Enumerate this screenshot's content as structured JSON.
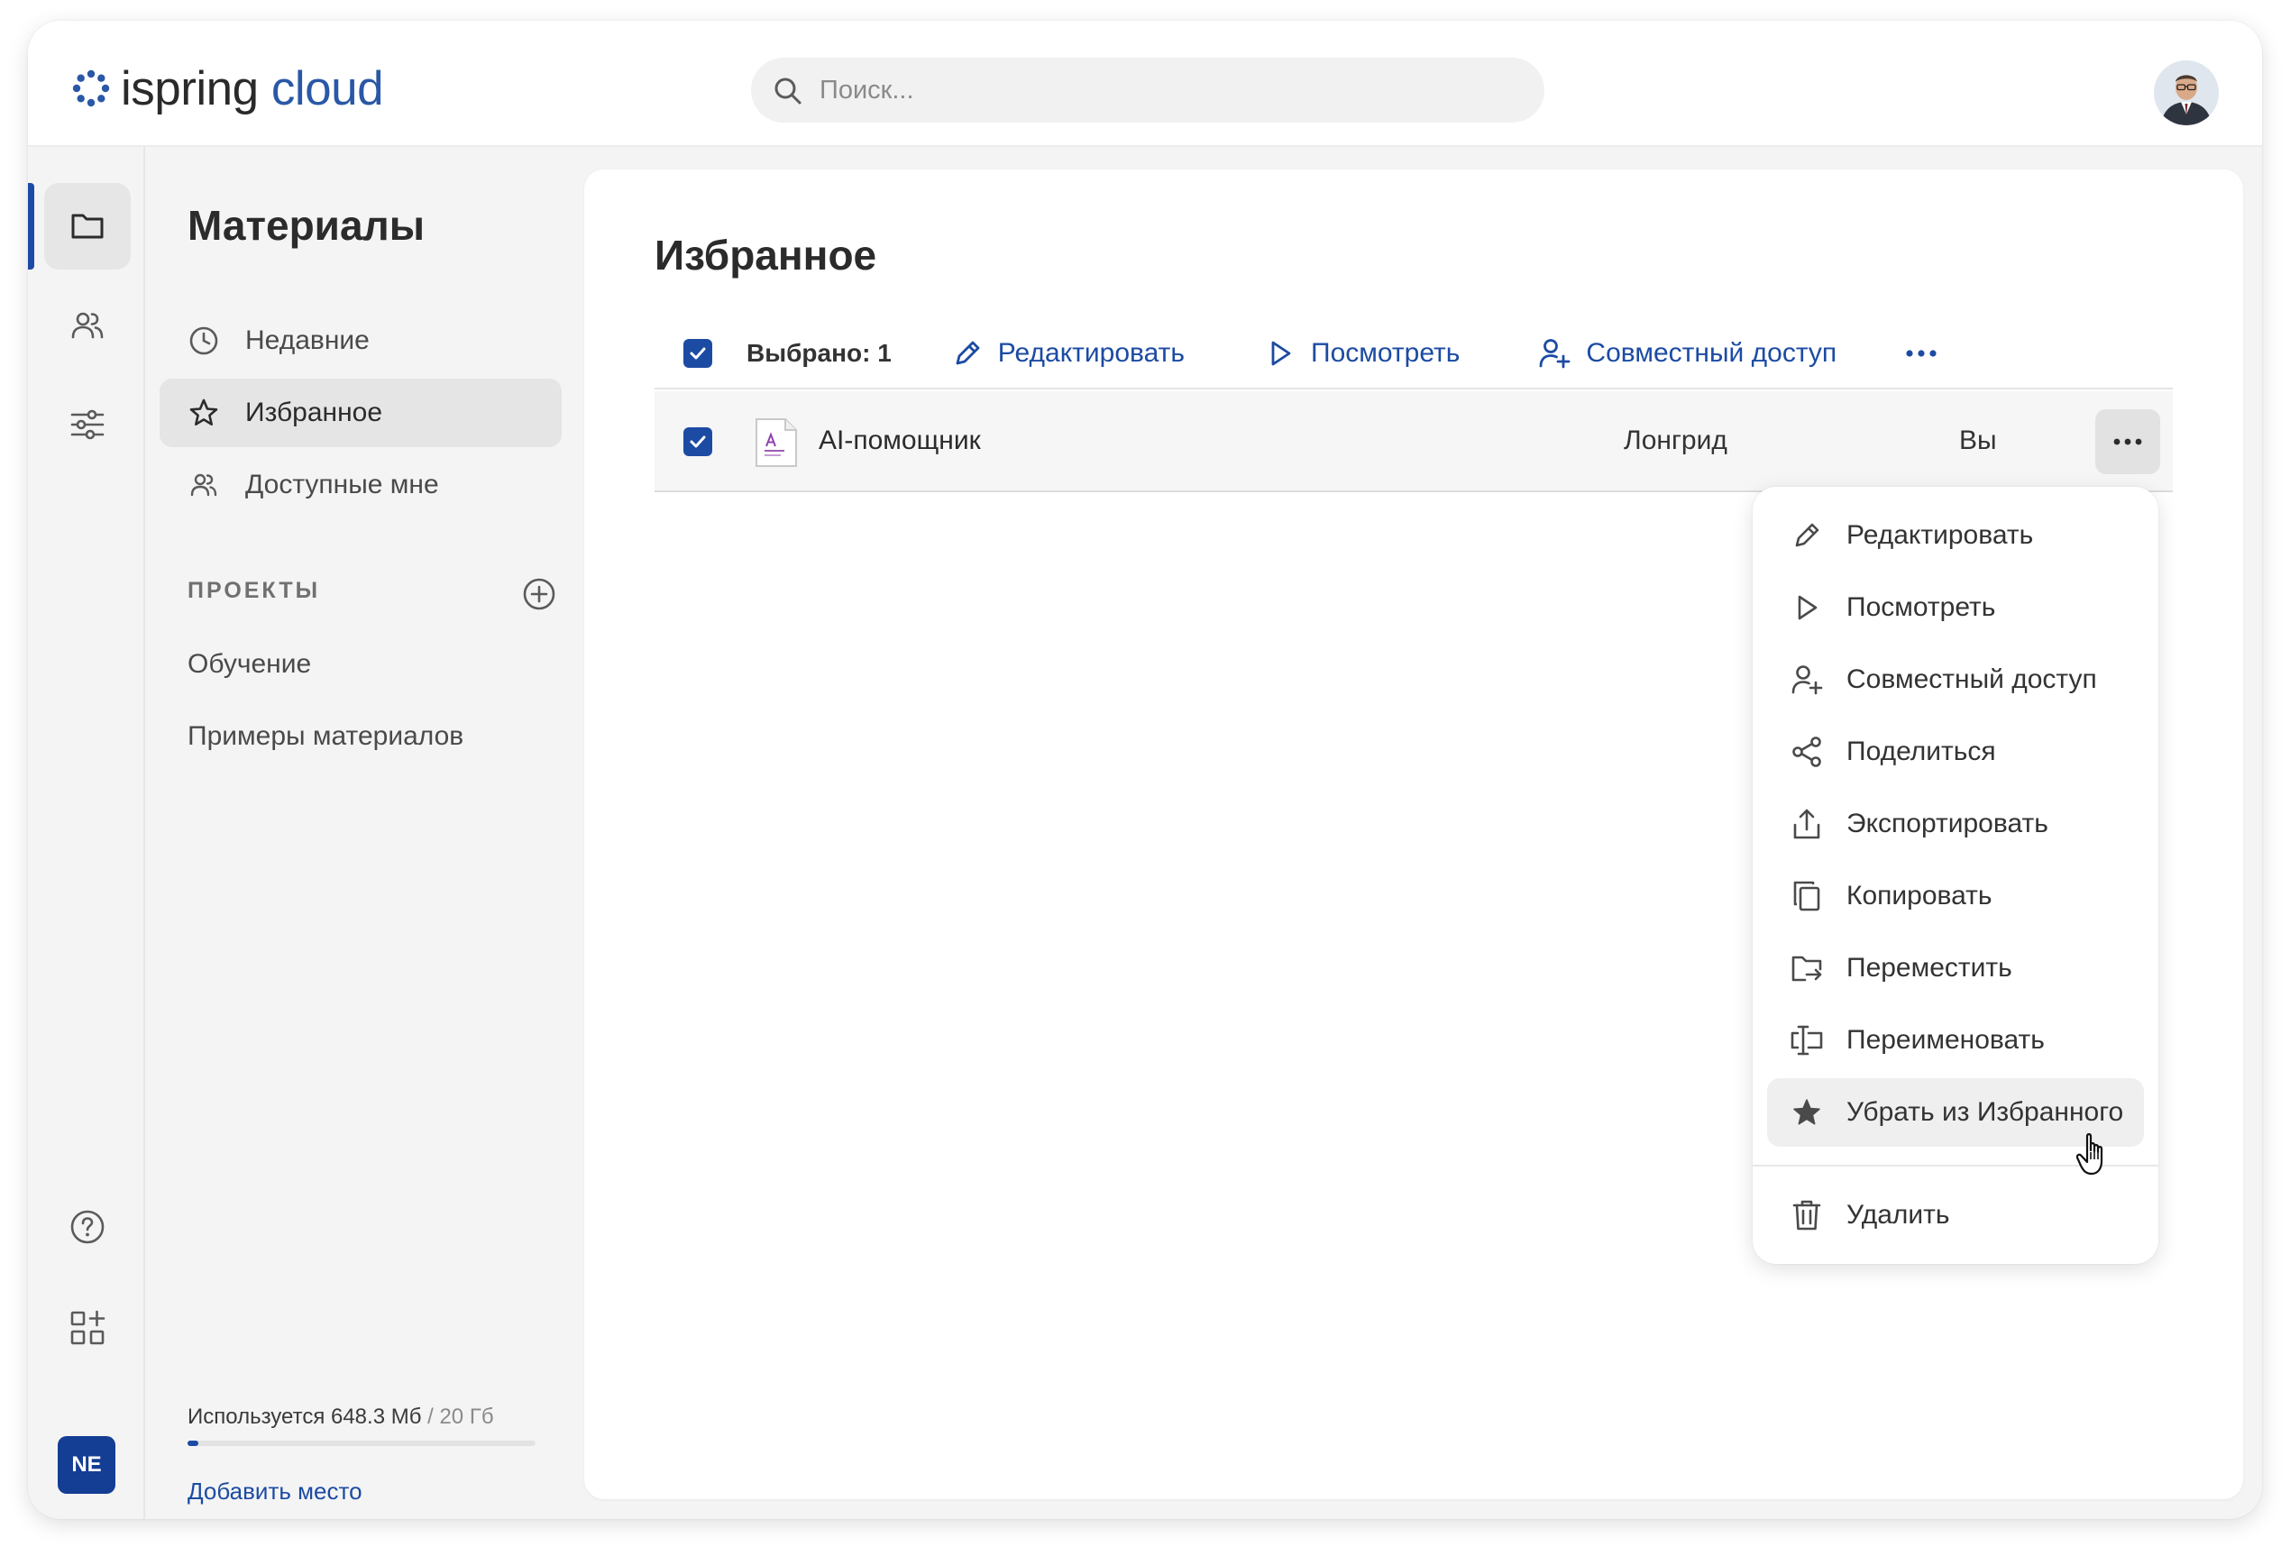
{
  "app": {
    "logo_part1": "ispring",
    "logo_part2": "cloud"
  },
  "search": {
    "placeholder": "Поиск..."
  },
  "colors": {
    "accent": "#1c4ba3",
    "logo_blue": "#2a58a6",
    "badge_bg": "#143d94"
  },
  "rail": {
    "items": [
      {
        "icon": "folder-icon",
        "active": true
      },
      {
        "icon": "users-icon",
        "active": false
      },
      {
        "icon": "sliders-icon",
        "active": false
      },
      {
        "icon": "help-icon",
        "active": false
      },
      {
        "icon": "apps-add-icon",
        "active": false
      }
    ],
    "user_initials": "NE"
  },
  "panel": {
    "title": "Материалы",
    "nav": [
      {
        "label": "Недавние",
        "icon": "clock-icon",
        "active": false
      },
      {
        "label": "Избранное",
        "icon": "star-icon",
        "active": true
      },
      {
        "label": "Доступные мне",
        "icon": "users-icon",
        "active": false
      }
    ],
    "projects_header": "ПРОЕКТЫ",
    "projects": [
      {
        "label": "Обучение"
      },
      {
        "label": "Примеры материалов"
      }
    ],
    "storage": {
      "used_label": "Используется 648.3 Мб",
      "total_label": "/ 20 Гб",
      "used_fraction": 0.032
    },
    "add_space": "Добавить место"
  },
  "main": {
    "title": "Избранное",
    "toolbar": {
      "selected_label": "Выбрано: 1",
      "edit": "Редактировать",
      "view": "Посмотреть",
      "share_access": "Совместный доступ"
    },
    "rows": [
      {
        "name": "AI-помощник",
        "type": "Лонгрид",
        "owner": "Вы",
        "checked": true
      }
    ]
  },
  "context_menu": {
    "items": [
      {
        "label": "Редактировать",
        "icon": "pencil-icon"
      },
      {
        "label": "Посмотреть",
        "icon": "play-icon"
      },
      {
        "label": "Совместный доступ",
        "icon": "user-plus-icon"
      },
      {
        "label": "Поделиться",
        "icon": "share-icon"
      },
      {
        "label": "Экспортировать",
        "icon": "export-icon"
      },
      {
        "label": "Копировать",
        "icon": "copy-icon"
      },
      {
        "label": "Переместить",
        "icon": "move-icon"
      },
      {
        "label": "Переименовать",
        "icon": "rename-icon"
      },
      {
        "label": "Убрать из Избранного",
        "icon": "star-filled-icon",
        "hovered": true
      }
    ],
    "delete_label": "Удалить"
  }
}
